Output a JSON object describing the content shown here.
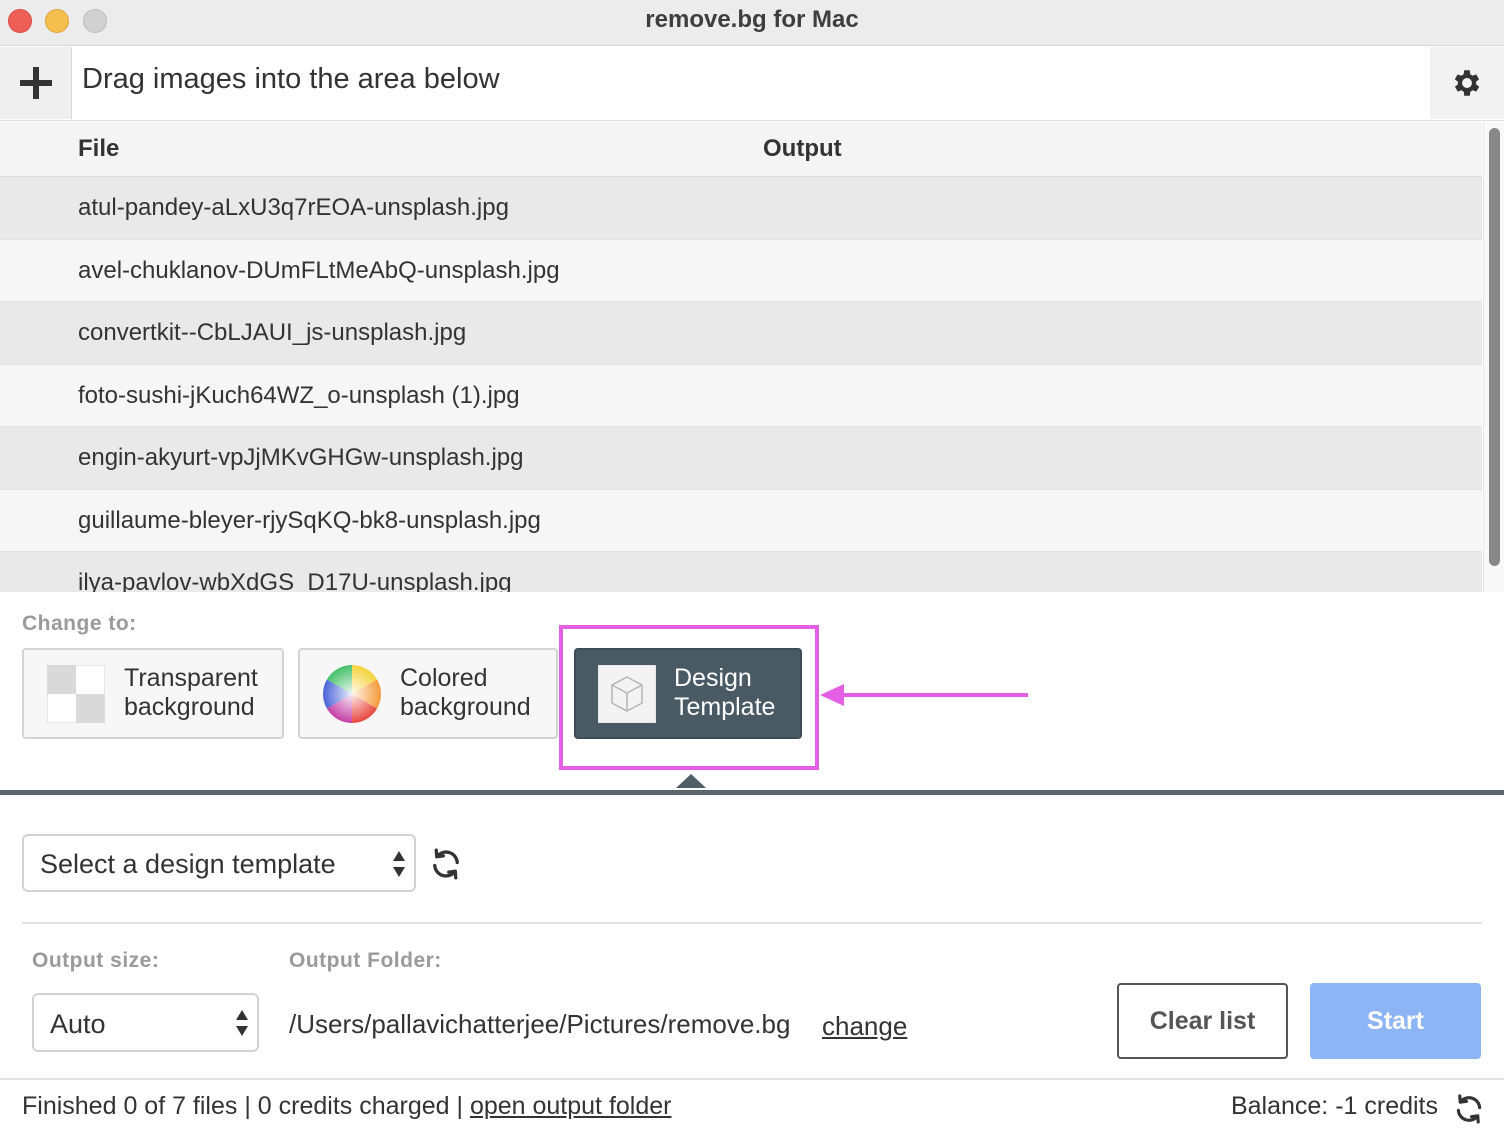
{
  "window": {
    "title": "remove.bg for Mac"
  },
  "toolbar": {
    "add_icon": "plus-icon",
    "drag_hint": "Drag images into the area below",
    "settings_icon": "gear-icon"
  },
  "table": {
    "columns": [
      "File",
      "Output"
    ],
    "rows": [
      {
        "file": "atul-pandey-aLxU3q7rEOA-unsplash.jpg",
        "output": ""
      },
      {
        "file": "avel-chuklanov-DUmFLtMeAbQ-unsplash.jpg",
        "output": ""
      },
      {
        "file": "convertkit--CbLJAUI_js-unsplash.jpg",
        "output": ""
      },
      {
        "file": "foto-sushi-jKuch64WZ_o-unsplash (1).jpg",
        "output": ""
      },
      {
        "file": "engin-akyurt-vpJjMKvGHGw-unsplash.jpg",
        "output": ""
      },
      {
        "file": "guillaume-bleyer-rjySqKQ-bk8-unsplash.jpg",
        "output": ""
      },
      {
        "file": "ilya-pavlov-wbXdGS_D17U-unsplash.jpg",
        "output": ""
      }
    ]
  },
  "change_to": {
    "label": "Change to:",
    "options": [
      {
        "line1": "Transparent",
        "line2": "background",
        "icon": "checkerboard-icon",
        "selected": false
      },
      {
        "line1": "Colored",
        "line2": "background",
        "icon": "color-wheel-icon",
        "selected": false
      },
      {
        "line1": "Design",
        "line2": "Template",
        "icon": "cube-icon",
        "selected": true
      }
    ],
    "annotation_color": "#e45fe4"
  },
  "design": {
    "template_select": "Select a design template",
    "refresh_icon": "refresh-icon"
  },
  "output": {
    "size_label": "Output size:",
    "size_value": "Auto",
    "folder_label": "Output Folder:",
    "folder_path": "/Users/pallavichatterjee/Pictures/remove.bg",
    "change_link": "change"
  },
  "actions": {
    "clear": "Clear list",
    "start": "Start",
    "start_color": "#8db4f4"
  },
  "status": {
    "summary": "Finished 0 of 7 files | 0 credits charged | ",
    "open_folder": "open output folder",
    "balance": "Balance: -1 credits"
  }
}
